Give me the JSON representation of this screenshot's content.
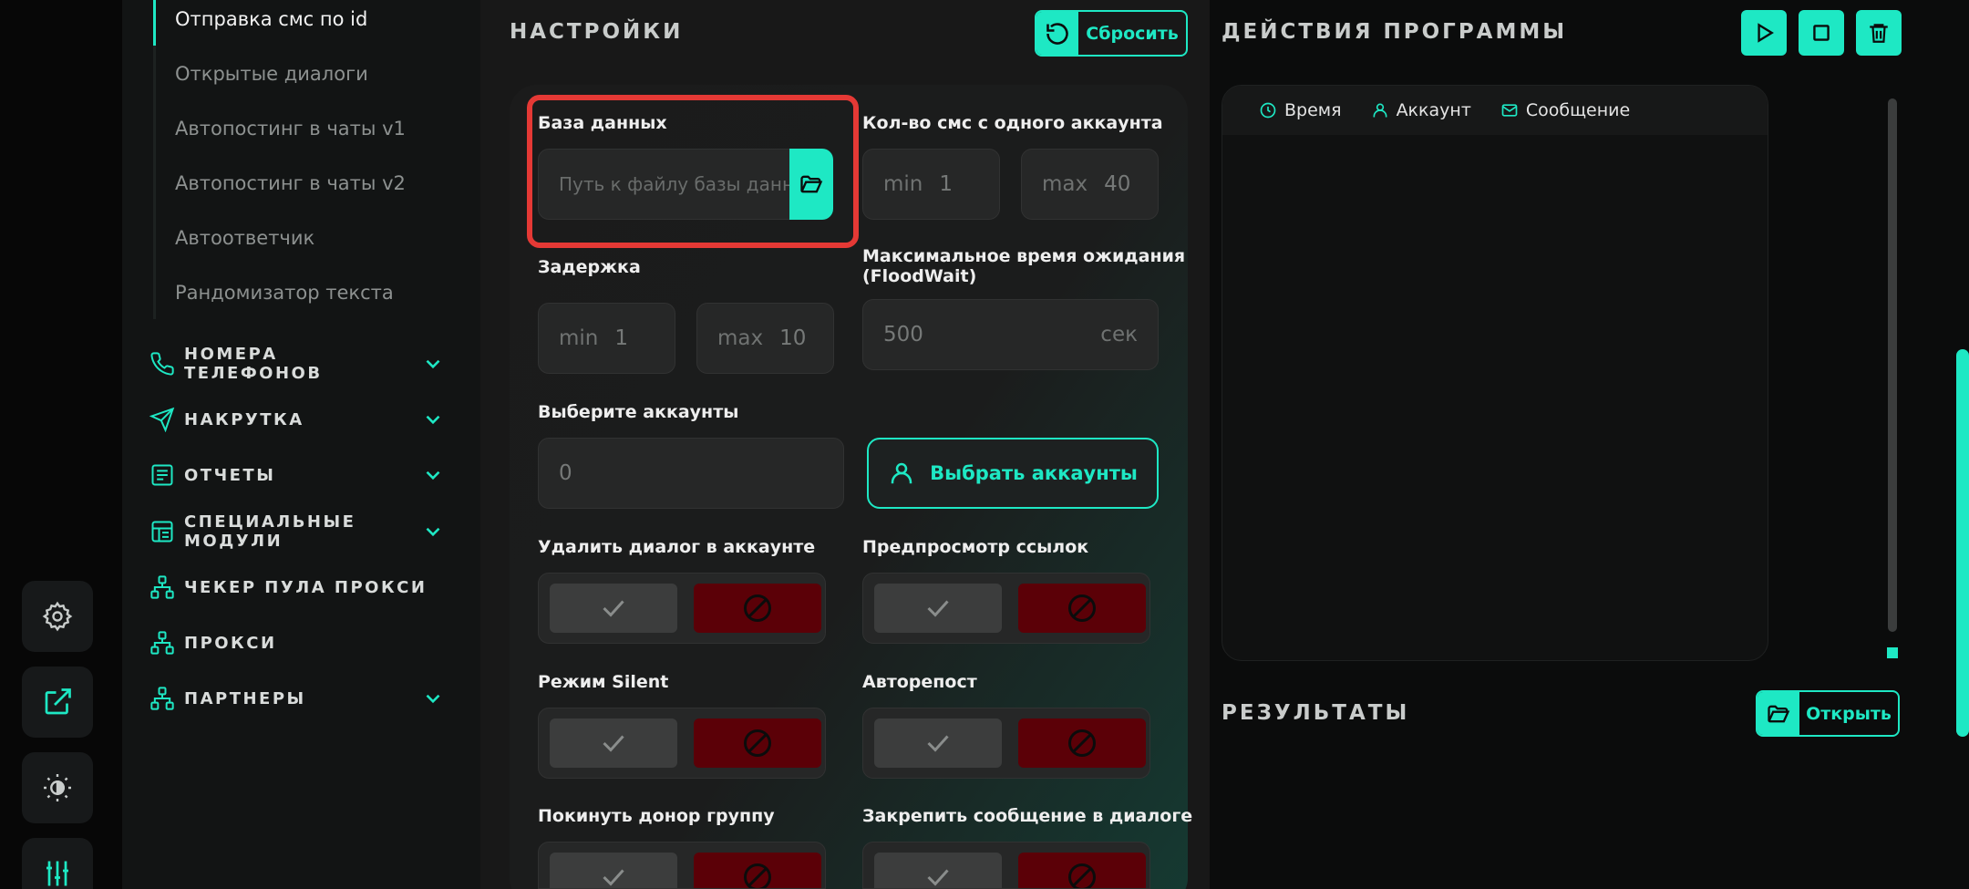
{
  "colors": {
    "accent": "#1ee8c4",
    "danger": "#5b0007",
    "highlight": "#e53935"
  },
  "rail": {
    "icons": [
      "gear-icon",
      "external-link-icon",
      "brightness-icon",
      "sliders-icon"
    ]
  },
  "nav": {
    "sub_items": [
      {
        "label": "Отправка смс по id",
        "active": true
      },
      {
        "label": "Открытые диалоги"
      },
      {
        "label": "Автопостинг в чаты v1"
      },
      {
        "label": "Автопостинг в чаты v2"
      },
      {
        "label": "Автоответчик"
      },
      {
        "label": "Рандомизатор текста"
      }
    ],
    "groups": [
      {
        "label": "НОМЕРА ТЕЛЕФОНОВ",
        "icon": "phone-icon",
        "expandable": true
      },
      {
        "label": "НАКРУТКА",
        "icon": "send-icon",
        "expandable": true
      },
      {
        "label": "ОТЧЕТЫ",
        "icon": "report-icon",
        "expandable": true
      },
      {
        "label": "СПЕЦИАЛЬНЫЕ МОДУЛИ",
        "icon": "modules-icon",
        "expandable": true
      },
      {
        "label": "ЧЕКЕР ПУЛА ПРОКСИ",
        "icon": "network-icon",
        "expandable": false
      },
      {
        "label": "ПРОКСИ",
        "icon": "network-icon",
        "expandable": false
      },
      {
        "label": "ПАРТНЕРЫ",
        "icon": "network-icon",
        "expandable": true
      }
    ]
  },
  "settings": {
    "title": "НАСТРОЙКИ",
    "reset_label": "Сбросить",
    "database": {
      "label": "База данных",
      "placeholder": "Путь к файлу базы данных"
    },
    "sms_per_account": {
      "label": "Кол-во смс с одного аккаунта",
      "min_label": "min",
      "min_value": "1",
      "max_label": "max",
      "max_value": "40"
    },
    "delay": {
      "label": "Задержка",
      "min_label": "min",
      "min_value": "1",
      "max_label": "max",
      "max_value": "10"
    },
    "flood_wait": {
      "label_line1": "Максимальное время ожидания",
      "label_line2": "(FloodWait)",
      "value": "500",
      "unit": "сек"
    },
    "accounts": {
      "label": "Выберите аккаунты",
      "value": "0",
      "choose_label": "Выбрать аккаунты"
    },
    "toggles": [
      {
        "label": "Удалить диалог в аккаунте",
        "state": "off"
      },
      {
        "label": "Предпросмотр ссылок",
        "state": "off"
      },
      {
        "label": "Режим Silent",
        "state": "off"
      },
      {
        "label": "Авторепост",
        "state": "off"
      },
      {
        "label": "Покинуть донор группу",
        "state": "off"
      },
      {
        "label": "Закрепить сообщение в диалоге",
        "state": "off"
      }
    ]
  },
  "actions": {
    "title": "ДЕЙСТВИЯ ПРОГРАММЫ",
    "controls": [
      "play-icon",
      "stop-icon",
      "trash-icon"
    ],
    "columns": [
      {
        "label": "Время",
        "icon": "clock-icon"
      },
      {
        "label": "Аккаунт",
        "icon": "user-icon"
      },
      {
        "label": "Сообщение",
        "icon": "mail-icon"
      }
    ]
  },
  "results": {
    "title": "РЕЗУЛЬТАТЫ",
    "open_label": "Открыть"
  }
}
